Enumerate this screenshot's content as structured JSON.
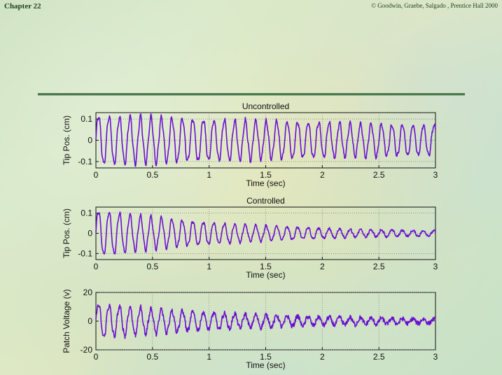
{
  "header": {
    "chapter": "Chapter 22",
    "copyright": "© Goodwin, Graebe, Salgado , Prentice Hall 2000"
  },
  "colors": {
    "trace": "#6a0fd0",
    "grid": "#777777"
  },
  "chart_data": [
    {
      "type": "line",
      "title": "Uncontrolled",
      "xlabel": "Time (sec)",
      "ylabel": "Tip Pos. (cm)",
      "xlim": [
        0,
        3
      ],
      "ylim": [
        -0.13,
        0.13
      ],
      "xticks": [
        0,
        0.5,
        1,
        1.5,
        2,
        2.5,
        3
      ],
      "xticklabels": [
        "0",
        "0.5",
        "1",
        "1.5",
        "2",
        "2.5",
        "3"
      ],
      "yticks": [
        -0.1,
        0,
        0.1
      ],
      "yticklabels": [
        "-0.1",
        "0",
        "0.1"
      ],
      "grid": true,
      "series": [
        {
          "frequency_hz": 10.8,
          "initial_amplitude": 0.115,
          "final_amplitude": 0.07,
          "noise": 0.006
        }
      ]
    },
    {
      "type": "line",
      "title": "Controlled",
      "xlabel": "Time (sec)",
      "ylabel": "Tip Pos. (cm)",
      "xlim": [
        0,
        3
      ],
      "ylim": [
        -0.13,
        0.13
      ],
      "xticks": [
        0,
        0.5,
        1,
        1.5,
        2,
        2.5,
        3
      ],
      "xticklabels": [
        "0",
        "0.5",
        "1",
        "1.5",
        "2",
        "2.5",
        "3"
      ],
      "yticks": [
        -0.1,
        0,
        0.1
      ],
      "yticklabels": [
        "-0.1",
        "0",
        "0.1"
      ],
      "grid": true,
      "series": [
        {
          "frequency_hz": 10.8,
          "initial_amplitude": 0.115,
          "final_amplitude": 0.012,
          "noise": 0.005
        }
      ]
    },
    {
      "type": "line",
      "title": "",
      "xlabel": "Time (sec)",
      "ylabel": "Patch Voltage (v)",
      "xlim": [
        0,
        3
      ],
      "ylim": [
        -20,
        20
      ],
      "xticks": [
        0,
        0.5,
        1,
        1.5,
        2,
        2.5,
        3
      ],
      "xticklabels": [
        "0",
        "0.5",
        "1",
        "1.5",
        "2",
        "2.5",
        "3"
      ],
      "yticks": [
        -20,
        0,
        20
      ],
      "yticklabels": [
        "-20",
        "0",
        "20"
      ],
      "grid": true,
      "series": [
        {
          "frequency_hz": 10.8,
          "initial_amplitude": 12,
          "final_amplitude": 1.5,
          "noise": 1.5
        }
      ]
    }
  ]
}
